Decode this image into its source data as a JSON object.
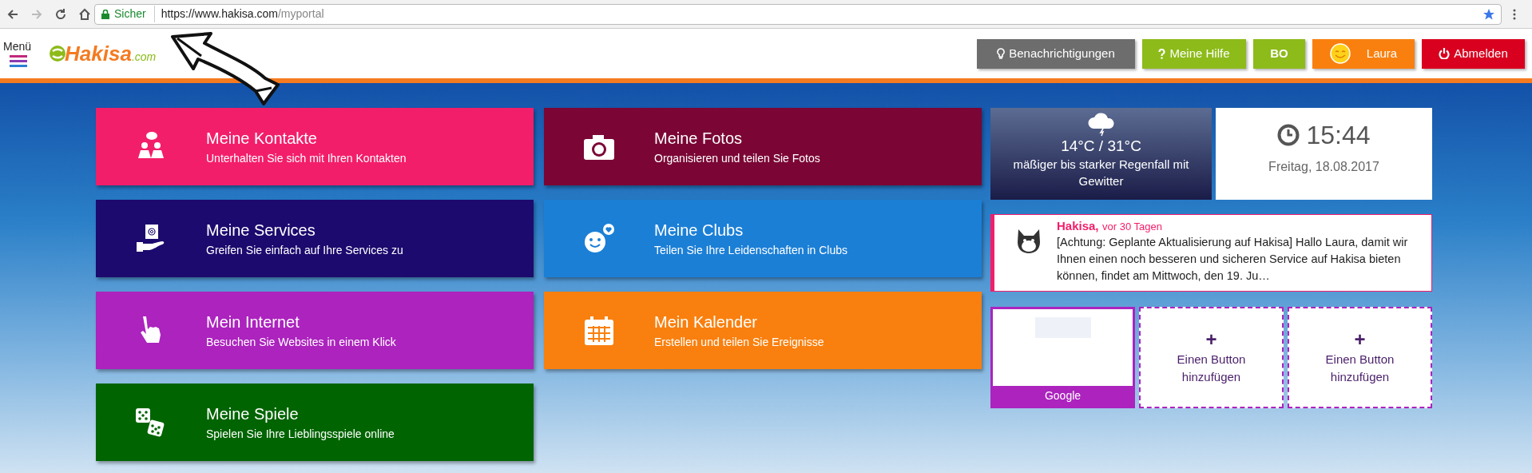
{
  "browser": {
    "security_label": "Sicher",
    "url_host": "https://www.hakisa.com",
    "url_path": "/myportal"
  },
  "header": {
    "menu_label": "Menü",
    "logo": "Hakisa",
    "logo_suffix": ".com",
    "buttons": [
      {
        "kind": "notifications",
        "label": "Benachrichtigungen",
        "color": "#6d6d6d"
      },
      {
        "kind": "help",
        "label": "Meine Hilfe",
        "color": "#8dbb1a"
      },
      {
        "kind": "plain",
        "label": "BO",
        "color": "#8dbb1a"
      },
      {
        "kind": "profile",
        "label": "Laura",
        "color": "#f9800f"
      },
      {
        "kind": "logout",
        "label": "Abmelden",
        "color": "#d9001f"
      }
    ]
  },
  "tiles": [
    {
      "kind": "contacts",
      "title": "Meine Kontakte",
      "subtitle": "Unterhalten Sie sich mit Ihren Kontakten",
      "color": "#f31e6a"
    },
    {
      "kind": "photos",
      "title": "Meine Fotos",
      "subtitle": "Organisieren und teilen Sie Fotos",
      "color": "#7b0635"
    },
    {
      "kind": "services",
      "title": "Meine Services",
      "subtitle": "Greifen Sie einfach auf Ihre Services zu",
      "color": "#1c0a6e"
    },
    {
      "kind": "clubs",
      "title": "Meine Clubs",
      "subtitle": "Teilen Sie Ihre Leidenschaften in Clubs",
      "color": "#1b7fd6"
    },
    {
      "kind": "internet",
      "title": "Mein Internet",
      "subtitle": "Besuchen Sie Websites in einem Klick",
      "color": "#ac23be"
    },
    {
      "kind": "calendar",
      "title": "Mein Kalender",
      "subtitle": "Erstellen und teilen Sie Ereignisse",
      "color": "#f9800f"
    },
    {
      "kind": "games",
      "title": "Meine Spiele",
      "subtitle": "Spielen Sie Ihre Lieblingsspiele online",
      "color": "#006400"
    }
  ],
  "weather": {
    "temperature": "14°C / 31°C",
    "description": "mäßiger bis starker Regenfall mit Gewitter"
  },
  "clock": {
    "time": "15:44",
    "date": "Freitag, 18.08.2017"
  },
  "message": {
    "sender": "Hakisa,",
    "age": "vor 30 Tagen",
    "text": "[Achtung: Geplante Aktualisierung auf Hakisa] Hallo Laura, damit wir Ihnen einen noch besseren und sicheren Service auf Hakisa bieten können, findet am Mittwoch, den 19. Ju…"
  },
  "shortcuts": [
    {
      "kind": "site",
      "label": "Google"
    },
    {
      "kind": "add",
      "symbol": "+",
      "label": "Einen Button hinzufügen"
    },
    {
      "kind": "add",
      "symbol": "+",
      "label": "Einen Button hinzufügen"
    }
  ]
}
